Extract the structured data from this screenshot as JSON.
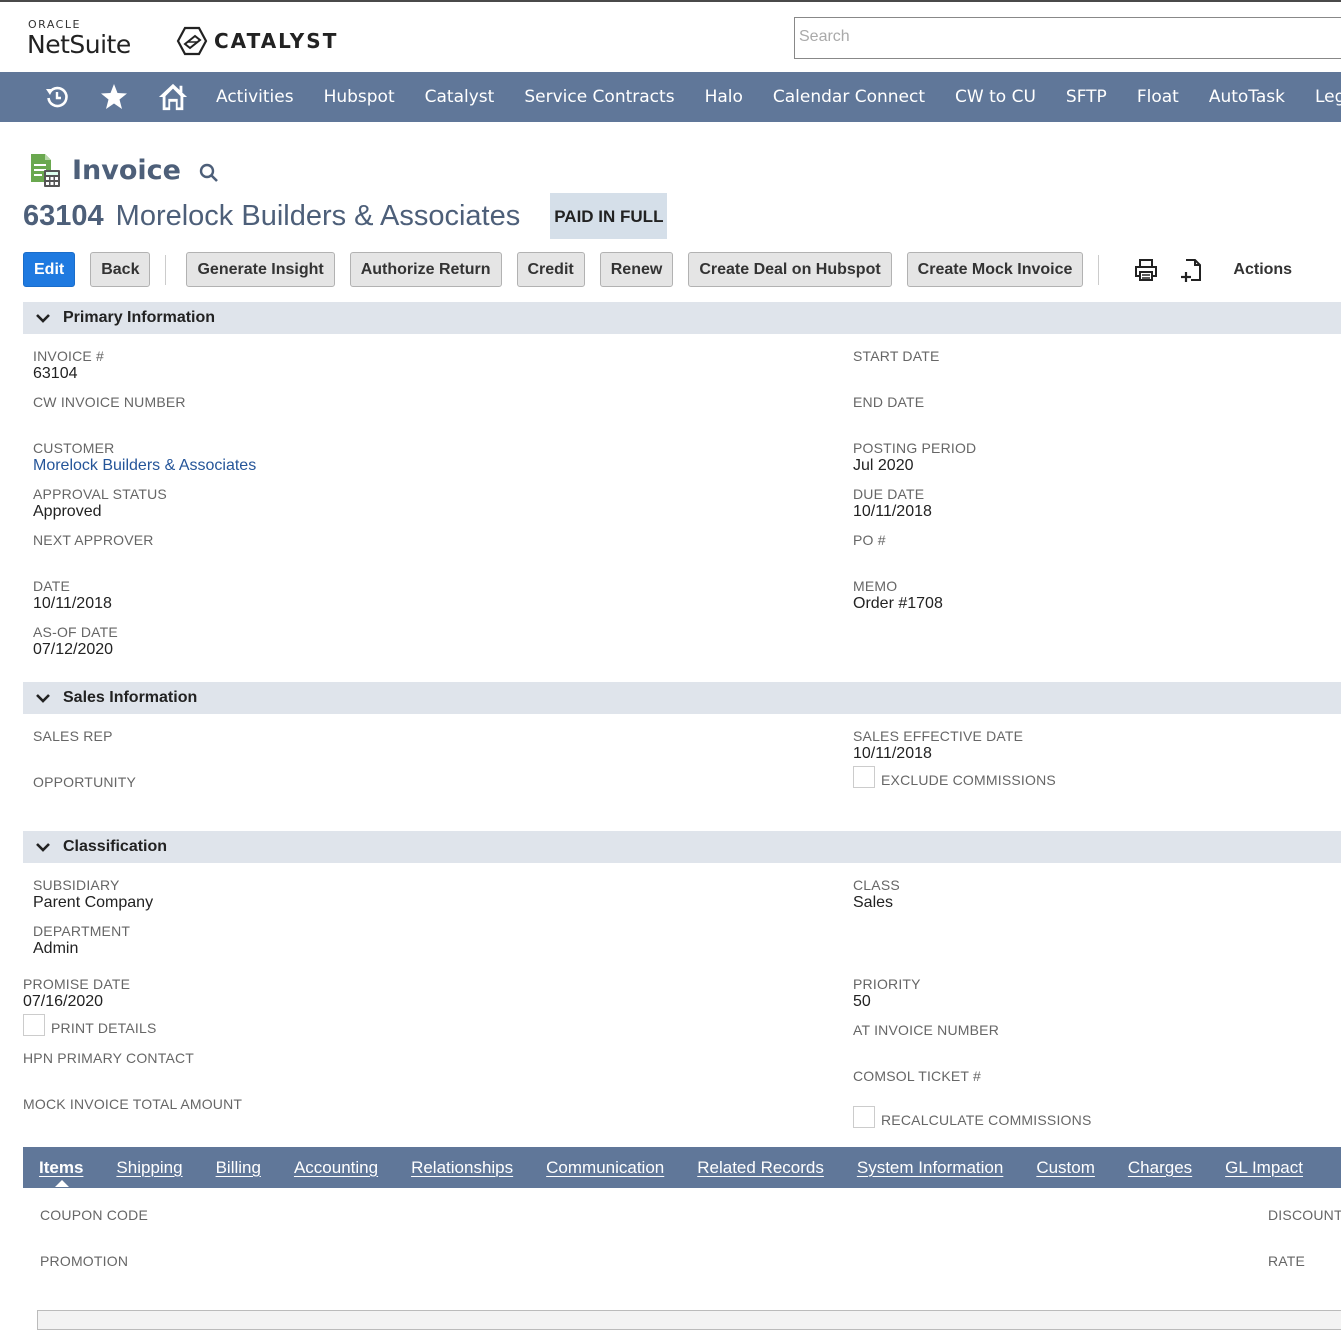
{
  "header": {
    "logo_oracle": "ORACLE",
    "logo_netsuite": "NetSuite",
    "logo_catalyst": "CATALYST",
    "search_placeholder": "Search"
  },
  "nav": {
    "icons": [
      "recent-records-icon",
      "favorites-star-icon",
      "home-icon"
    ],
    "items": [
      "Activities",
      "Hubspot",
      "Catalyst",
      "Service Contracts",
      "Halo",
      "Calendar Connect",
      "CW to CU",
      "SFTP",
      "Float",
      "AutoTask",
      "Leg"
    ]
  },
  "page": {
    "title": "Invoice",
    "record_number": "63104",
    "record_name": "Morelock Builders & Associates",
    "status_badge": "PAID IN FULL"
  },
  "buttons": {
    "edit": "Edit",
    "back": "Back",
    "generate_insight": "Generate Insight",
    "authorize_return": "Authorize Return",
    "credit": "Credit",
    "renew": "Renew",
    "create_deal": "Create Deal on Hubspot",
    "create_mock": "Create Mock Invoice",
    "actions": "Actions"
  },
  "primary": {
    "title": "Primary Information",
    "invoice_no": {
      "label": "INVOICE #",
      "value": "63104"
    },
    "cw_invoice": {
      "label": "CW INVOICE NUMBER",
      "value": ""
    },
    "customer": {
      "label": "CUSTOMER",
      "value": "Morelock Builders & Associates"
    },
    "approval_status": {
      "label": "APPROVAL STATUS",
      "value": "Approved"
    },
    "next_approver": {
      "label": "NEXT APPROVER",
      "value": ""
    },
    "date": {
      "label": "DATE",
      "value": "10/11/2018"
    },
    "as_of_date": {
      "label": "AS-OF DATE",
      "value": "07/12/2020"
    },
    "start_date": {
      "label": "START DATE",
      "value": ""
    },
    "end_date": {
      "label": "END DATE",
      "value": ""
    },
    "posting_period": {
      "label": "POSTING PERIOD",
      "value": "Jul 2020"
    },
    "due_date": {
      "label": "DUE DATE",
      "value": "10/11/2018"
    },
    "po": {
      "label": "PO #",
      "value": ""
    },
    "memo": {
      "label": "MEMO",
      "value": "Order #1708"
    }
  },
  "sales": {
    "title": "Sales Information",
    "sales_rep": {
      "label": "SALES REP",
      "value": ""
    },
    "opportunity": {
      "label": "OPPORTUNITY",
      "value": ""
    },
    "sales_effective_date": {
      "label": "SALES EFFECTIVE DATE",
      "value": "10/11/2018"
    },
    "exclude_commissions": {
      "label": "EXCLUDE COMMISSIONS",
      "checked": false
    }
  },
  "classification": {
    "title": "Classification",
    "subsidiary": {
      "label": "SUBSIDIARY",
      "value": "Parent Company"
    },
    "department": {
      "label": "DEPARTMENT",
      "value": "Admin"
    },
    "promise_date": {
      "label": "PROMISE DATE",
      "value": "07/16/2020"
    },
    "print_details": {
      "label": "PRINT DETAILS",
      "checked": false
    },
    "hpn_primary_contact": {
      "label": "HPN PRIMARY CONTACT",
      "value": ""
    },
    "mock_invoice_total": {
      "label": "MOCK INVOICE TOTAL AMOUNT",
      "value": ""
    },
    "class": {
      "label": "CLASS",
      "value": "Sales"
    },
    "priority": {
      "label": "PRIORITY",
      "value": "50"
    },
    "at_invoice_number": {
      "label": "AT INVOICE NUMBER",
      "value": ""
    },
    "comsol_ticket": {
      "label": "COMSOL TICKET #",
      "value": ""
    },
    "recalculate_commissions": {
      "label": "RECALCULATE COMMISSIONS",
      "checked": false
    }
  },
  "tabs": [
    "Items",
    "Shipping",
    "Billing",
    "Accounting",
    "Relationships",
    "Communication",
    "Related Records",
    "System Information",
    "Custom",
    "Charges",
    "GL Impact"
  ],
  "items_tab": {
    "coupon_code": "COUPON CODE",
    "promotion": "PROMOTION",
    "discount": "DISCOUNT",
    "rate": "RATE"
  },
  "colors": {
    "nav_bg": "#607799",
    "title_blue": "#4d5f79",
    "edit_button": "#1f7ae0",
    "section_header": "#dfe4eb",
    "badge_bg": "#d5dfe9",
    "link": "#255599"
  }
}
